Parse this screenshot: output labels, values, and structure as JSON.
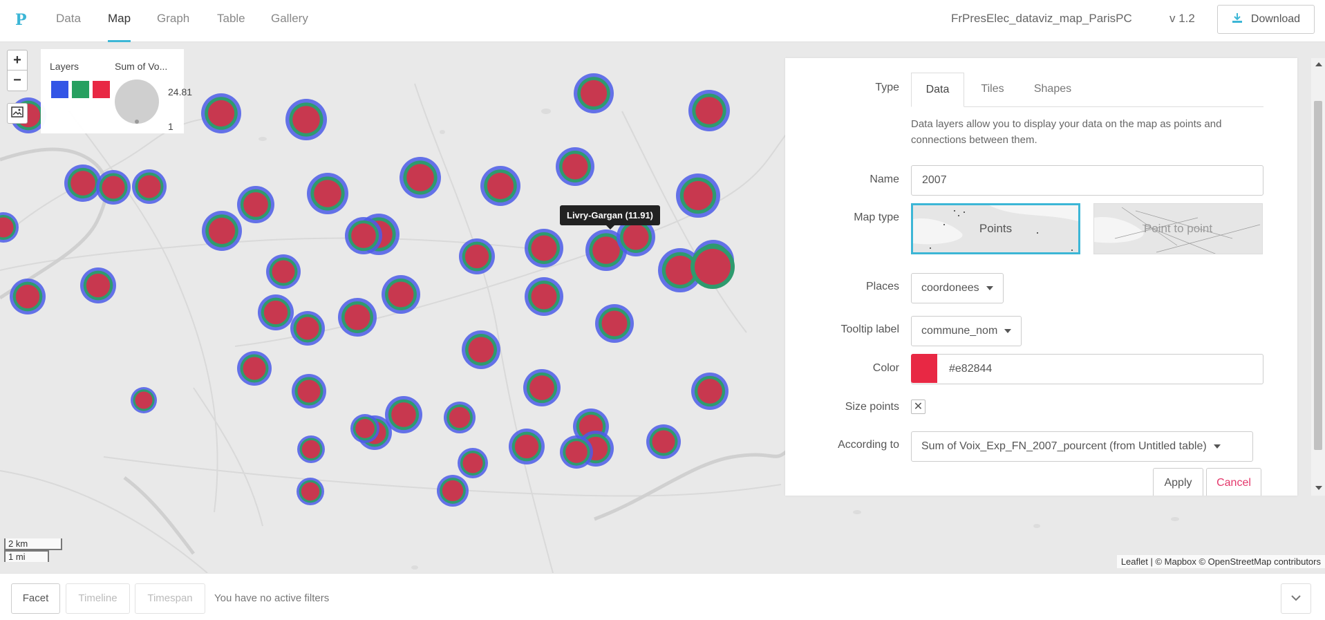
{
  "app": {
    "logo": "P",
    "project_title": "FrPresElec_dataviz_map_ParisPC",
    "version": "v 1.2",
    "download_label": "Download"
  },
  "nav": {
    "tabs": [
      {
        "label": "Data",
        "active": false
      },
      {
        "label": "Map",
        "active": true
      },
      {
        "label": "Graph",
        "active": false
      },
      {
        "label": "Table",
        "active": false
      },
      {
        "label": "Gallery",
        "active": false
      }
    ]
  },
  "map": {
    "zoom_in": "+",
    "zoom_out": "−",
    "legend": {
      "layers_title": "Layers",
      "size_title": "Sum of Vo...",
      "layer_colors": [
        "#3355e6",
        "#27a060",
        "#e82844"
      ],
      "size_max": "24.81",
      "size_min": "1"
    },
    "tooltip": "Livry-Gargan (11.91)",
    "scale_km": "2 km",
    "scale_mi": "1 mi",
    "attribution": "Leaflet | © Mapbox © OpenStreetMap contributors",
    "colors": {
      "blue": "#4b5ce8",
      "green": "#2e9b6e",
      "red": "#c8384f"
    }
  },
  "panel": {
    "type_label": "Type",
    "tabs": [
      {
        "label": "Data",
        "active": true
      },
      {
        "label": "Tiles",
        "active": false
      },
      {
        "label": "Shapes",
        "active": false
      }
    ],
    "description": "Data layers allow you to display your data on the map as points and connections between them.",
    "name_label": "Name",
    "name_value": "2007",
    "map_type_label": "Map type",
    "map_types": [
      {
        "label": "Points",
        "selected": true
      },
      {
        "label": "Point to point",
        "selected": false
      }
    ],
    "places_label": "Places",
    "places_value": "coordonees",
    "tooltip_label": "Tooltip label",
    "tooltip_value": "commune_nom",
    "color_label": "Color",
    "color_value": "#e82844",
    "size_points_label": "Size points",
    "size_points_checked": "✕",
    "according_label": "According to",
    "according_value": "Sum of Voix_Exp_FN_2007_pourcent (from Untitled table)",
    "apply_label": "Apply",
    "cancel_label": "Cancel"
  },
  "footer": {
    "facet_label": "Facet",
    "timeline_label": "Timeline",
    "timespan_label": "Timespan",
    "status": "You have no active filters"
  }
}
